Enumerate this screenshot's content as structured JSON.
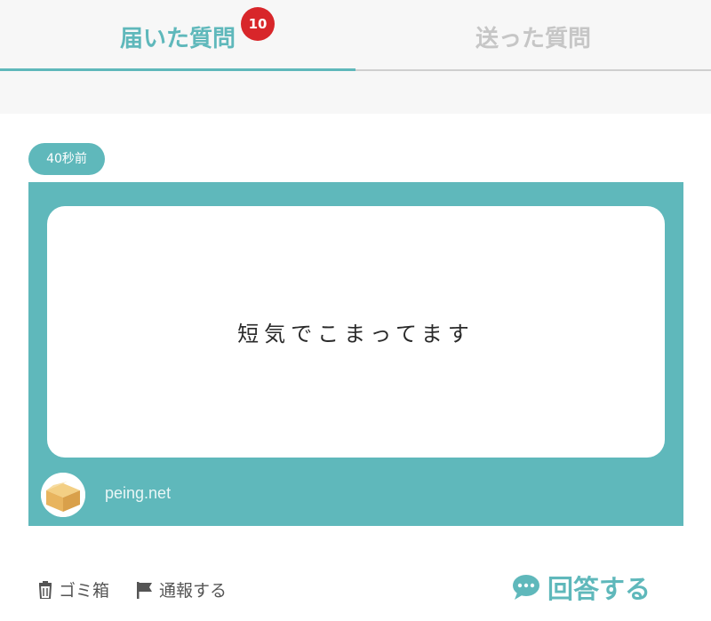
{
  "tabs": {
    "received_label": "届いた質問",
    "sent_label": "送った質問",
    "badge_count": "10"
  },
  "question": {
    "time_ago": "40秒前",
    "text": "短気でこまってます",
    "site": "peing.net",
    "avatar_icon": "cardboard-box-icon"
  },
  "actions": {
    "trash_label": "ゴミ箱",
    "trash_icon": "trash-icon",
    "report_label": "通報する",
    "report_icon": "flag-icon",
    "answer_label": "回答する",
    "answer_icon": "speech-bubble-icon"
  },
  "colors": {
    "accent": "#5fb8bb",
    "badge": "#d8262a",
    "inactive_tab": "#c6c6c6"
  }
}
